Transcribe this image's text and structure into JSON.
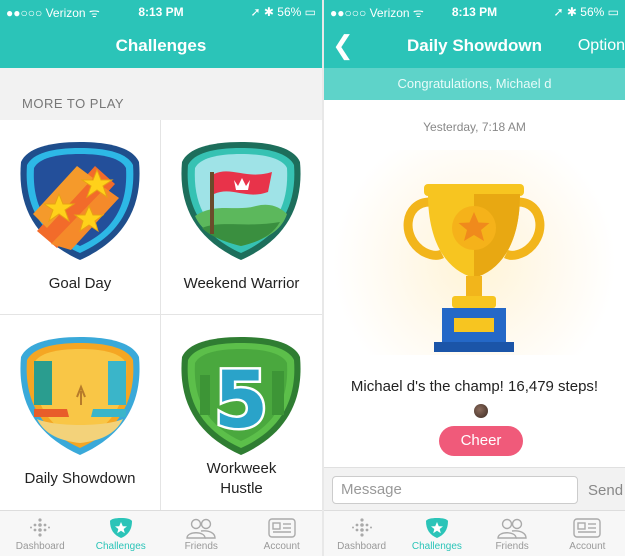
{
  "left_screen": {
    "status": {
      "carrier": "●●○○○ Verizon ᯤ",
      "time": "8:13 PM",
      "right": "➚ ✱ 56% ▭"
    },
    "nav_title": "Challenges",
    "section_heading": "MORE TO PLAY",
    "tiles": [
      {
        "label": "Goal Day"
      },
      {
        "label": "Weekend Warrior"
      },
      {
        "label": "Daily Showdown"
      },
      {
        "label_line1": "Workweek",
        "label_line2": "Hustle",
        "badge_number": "5"
      }
    ],
    "tabs": [
      "Dashboard",
      "Challenges",
      "Friends",
      "Account"
    ],
    "active_tab": "Challenges"
  },
  "right_screen": {
    "status": {
      "carrier": "●●○○○ Verizon ᯤ",
      "time": "8:13 PM",
      "right": "➚ ✱ 56% ▭"
    },
    "back_glyph": "❮",
    "nav_title": "Daily Showdown",
    "options_label": "Options",
    "congrats": "Congratulations, Michael d",
    "timestamp": "Yesterday, 7:18 AM",
    "champ_text": "Michael d's the champ! 16,479 steps!",
    "cheer_label": "Cheer",
    "message_placeholder": "Message",
    "send_label": "Send",
    "tabs": [
      "Dashboard",
      "Challenges",
      "Friends",
      "Account"
    ],
    "active_tab": "Challenges"
  },
  "colors": {
    "accent": "#2bc4b8",
    "banner": "#5ed3c9",
    "cheer": "#f05a7a",
    "trophy_gold": "#f7c520",
    "trophy_base": "#2468c7"
  },
  "icons": [
    "dashboard-dots-icon",
    "challenges-star-icon",
    "friends-icon",
    "account-card-icon"
  ]
}
